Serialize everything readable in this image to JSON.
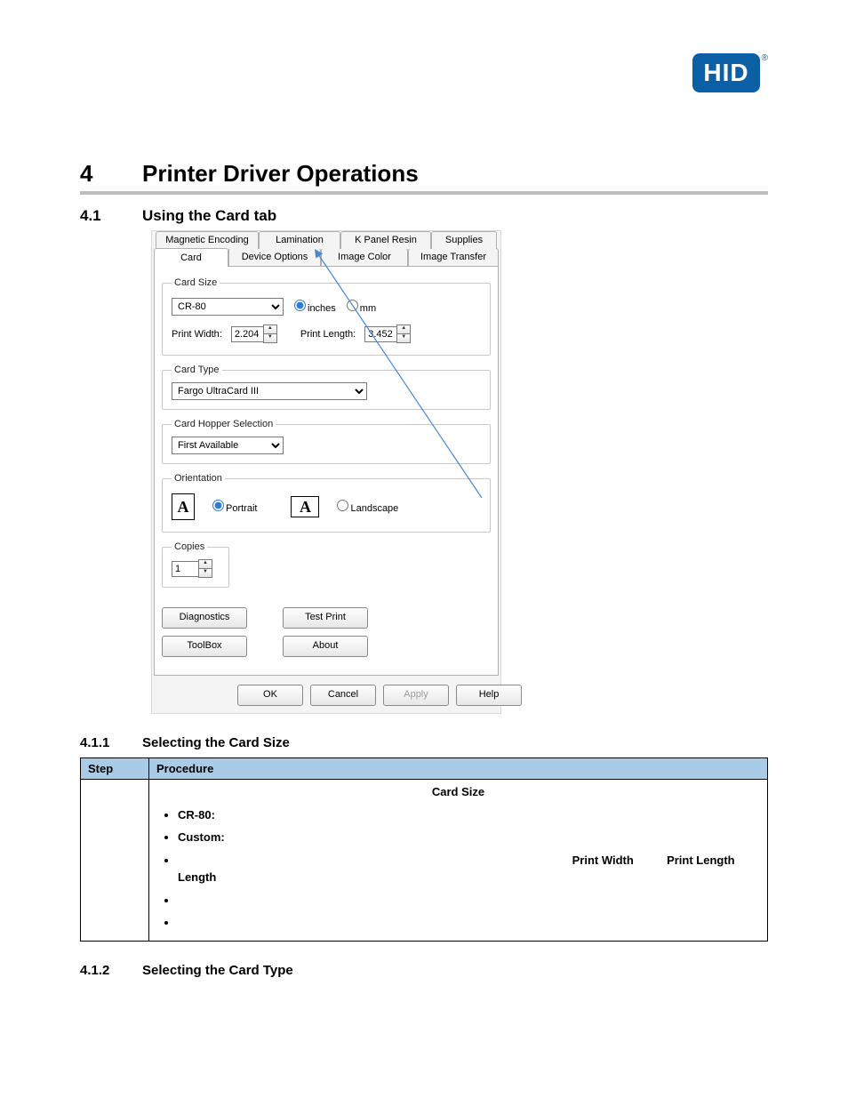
{
  "logo": {
    "text": "HID"
  },
  "chapter": {
    "num": "4",
    "title": "Printer Driver Operations"
  },
  "section_4_1": {
    "num": "4.1",
    "title": "Using the Card tab"
  },
  "dialog": {
    "tabs_back": [
      "Magnetic Encoding",
      "Lamination",
      "K Panel Resin",
      "Supplies"
    ],
    "tabs_front": [
      "Card",
      "Device Options",
      "Image Color",
      "Image Transfer"
    ],
    "card_size": {
      "legend": "Card Size",
      "combo": "CR-80",
      "unit_inches": "inches",
      "unit_mm": "mm",
      "print_width_label": "Print Width:",
      "print_width_value": "2.204",
      "print_length_label": "Print Length:",
      "print_length_value": "3.452"
    },
    "card_type": {
      "legend": "Card Type",
      "combo": "Fargo UltraCard III"
    },
    "hopper": {
      "legend": "Card Hopper Selection",
      "combo": "First Available"
    },
    "orientation": {
      "legend": "Orientation",
      "portrait": "Portrait",
      "landscape": "Landscape"
    },
    "copies": {
      "legend": "Copies",
      "value": "1"
    },
    "buttons": {
      "diagnostics": "Diagnostics",
      "test_print": "Test Print",
      "toolbox": "ToolBox",
      "about": "About",
      "ok": "OK",
      "cancel": "Cancel",
      "apply": "Apply",
      "help": "Help"
    }
  },
  "sub_4_1_1": {
    "num": "4.1.1",
    "title": "Selecting the Card Size"
  },
  "table_4_1_1": {
    "col_step": "Step",
    "col_proc": "Procedure",
    "content_heading": "Card Size",
    "bullet1_bold": "CR-80:",
    "bullet2_bold": "Custom:",
    "bullet3_bold1": "Print Width",
    "bullet3_bold2": "Print Length",
    "bullet3_rest": ""
  },
  "sub_4_1_2": {
    "num": "4.1.2",
    "title": "Selecting the Card Type"
  }
}
